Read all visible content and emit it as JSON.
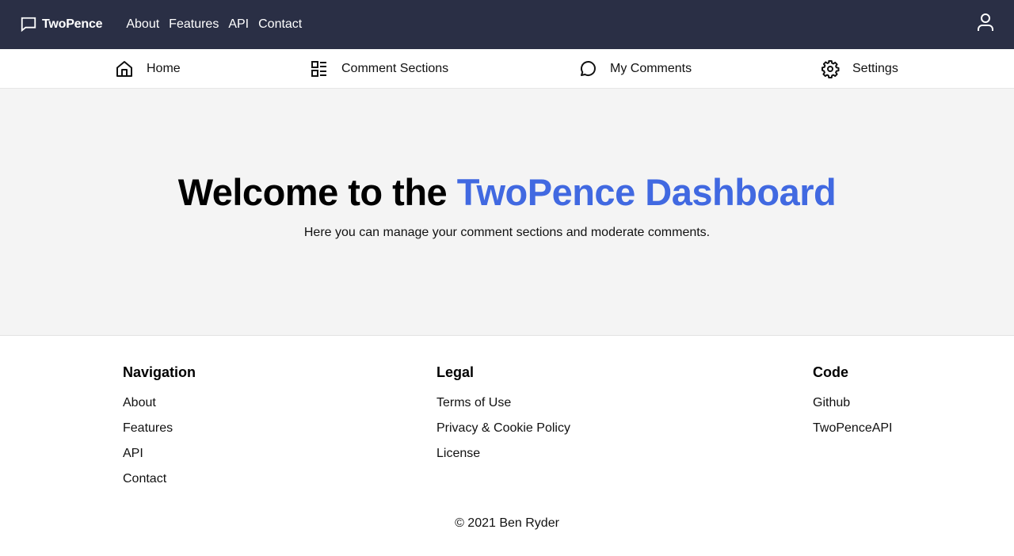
{
  "topbar": {
    "brand": "TwoPence",
    "brand_icon": "chat-bubble-icon",
    "links": [
      "About",
      "Features",
      "API",
      "Contact"
    ],
    "user_icon": "user-icon"
  },
  "subnav": {
    "items": [
      {
        "label": "Home",
        "icon": "home-icon"
      },
      {
        "label": "Comment Sections",
        "icon": "dashboard-list-icon"
      },
      {
        "label": "My Comments",
        "icon": "comment-icon"
      },
      {
        "label": "Settings",
        "icon": "gear-icon"
      }
    ]
  },
  "hero": {
    "title_prefix": "Welcome to the ",
    "title_accent": "TwoPence Dashboard",
    "subtitle": "Here you can manage your comment sections and moderate comments.",
    "accent_color": "#4169e1"
  },
  "footer": {
    "columns": [
      {
        "heading": "Navigation",
        "links": [
          "About",
          "Features",
          "API",
          "Contact"
        ]
      },
      {
        "heading": "Legal",
        "links": [
          "Terms of Use",
          "Privacy & Cookie Policy",
          "License"
        ]
      },
      {
        "heading": "Code",
        "links": [
          "Github",
          "TwoPenceAPI"
        ]
      }
    ],
    "copyright": "© 2021 Ben Ryder"
  }
}
